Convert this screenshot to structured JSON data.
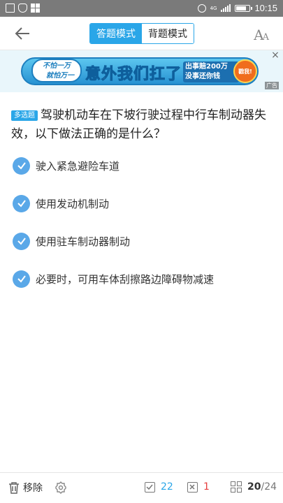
{
  "status_bar": {
    "network": "4G",
    "time": "10:15",
    "icons": [
      "image-icon",
      "shield-icon",
      "grid-icon",
      "alarm-icon",
      "signal-icon",
      "battery-icon"
    ]
  },
  "header": {
    "back_icon": "back-arrow-icon",
    "tabs": [
      {
        "label": "答题模式",
        "active": true
      },
      {
        "label": "背题模式",
        "active": false
      }
    ],
    "font_icon_label": "AA"
  },
  "ad": {
    "bubble_line1": "不怕一万",
    "bubble_line2": "就怕万一",
    "headline": "意外我们扛了",
    "sub_line1": "出事赔200万",
    "sub_line2": "没事还你钱",
    "cta": "戳我!",
    "close": "×",
    "tag": "广告"
  },
  "question": {
    "type": "多选题",
    "text": "驾驶机动车在下坡行驶过程中行车制动器失效，以下做法正确的是什么？"
  },
  "options": [
    {
      "text": "驶入紧急避险车道",
      "checked": true
    },
    {
      "text": "使用发动机制动",
      "checked": true
    },
    {
      "text": "使用驻车制动器制动",
      "checked": true
    },
    {
      "text": "必要时，可用车体刮擦路边障碍物减速",
      "checked": true
    }
  ],
  "bottom": {
    "remove_label": "移除",
    "correct_count": "22",
    "wrong_count": "1",
    "current": "20",
    "total": "/24"
  },
  "colors": {
    "accent": "#2aa6e8",
    "check": "#5aa8e8",
    "wrong": "#e53e3e"
  }
}
